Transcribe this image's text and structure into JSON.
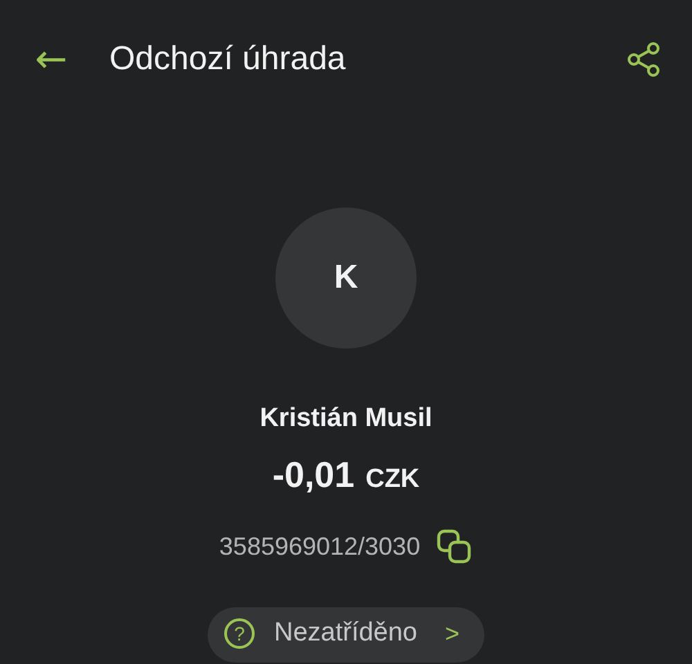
{
  "header": {
    "back_icon": "←",
    "title": "Odchozí úhrada"
  },
  "avatar": {
    "initial": "K"
  },
  "payee": {
    "name": "Kristián Musil"
  },
  "amount": {
    "value": "-0,01",
    "currency": "CZK"
  },
  "account": {
    "number": "3585969012/3030"
  },
  "category": {
    "icon": "?",
    "label": "Nezatříděno",
    "chevron": ">"
  }
}
